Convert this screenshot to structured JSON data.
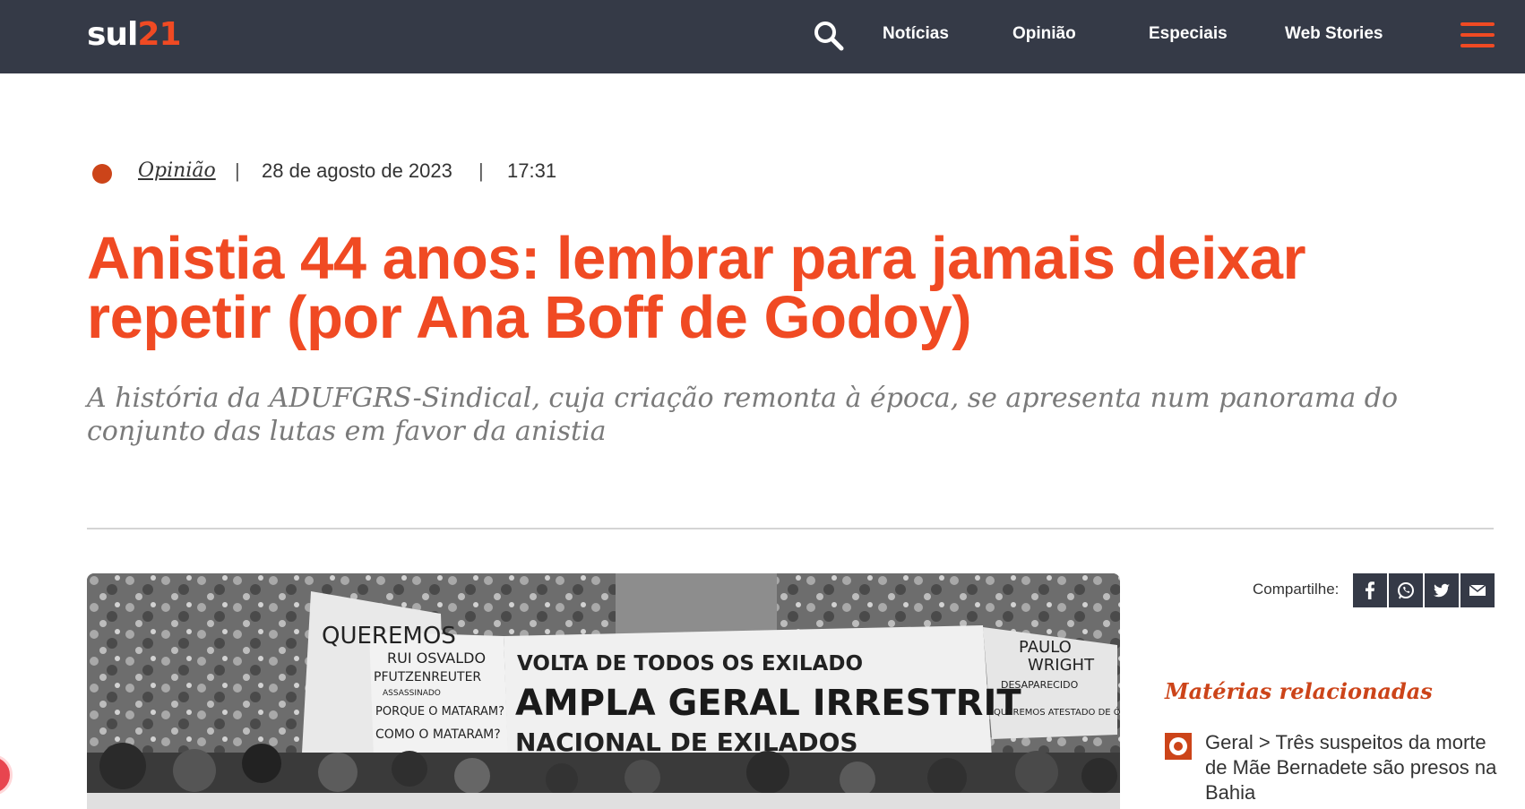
{
  "header": {
    "logo_part1": "sul",
    "logo_part2": "21",
    "nav": [
      "Notícias",
      "Opinião",
      "Especiais",
      "Web Stories"
    ]
  },
  "article": {
    "category": "Opinião",
    "separator": "|",
    "date": "28 de agosto de 2023",
    "time": "17:31",
    "title": "Anistia 44 anos: lembrar para jamais deixar repetir (por Ana Boff de Godoy)",
    "subtitle": "A história da ADUFGRS-Sindical, cuja criação remonta à época, se apresenta num panorama do conjunto das lutas em favor da anistia"
  },
  "share": {
    "label": "Compartilhe:",
    "buttons": [
      "facebook-icon",
      "whatsapp-icon",
      "twitter-icon",
      "email-icon"
    ]
  },
  "related": {
    "heading": "Matérias relacionadas",
    "items": [
      {
        "text": "Geral > Três suspeitos da morte de Mãe Bernadete são presos na Bahia"
      }
    ]
  },
  "hero_banners": {
    "b1": "QUEREMOS",
    "b2": "RUI OSVALDO",
    "b3": "PFUTZENREUTER",
    "b4": "ASSASSINADO",
    "b5": "PORQUE O MATARAM?",
    "b6": "COMO O MATARAM?",
    "b7": "VOLTA DE TODOS OS EXILADO",
    "b8": "AMPLA GERAL IRRESTRIT",
    "b9": "NACIONAL DE EXILADOS",
    "b10": "PAULO",
    "b11": "WRIGHT",
    "b12": "DESAPARECIDO",
    "b13": "QUEREMOS ATESTADO DE ÓBITO"
  },
  "colors": {
    "header_bg": "#353a47",
    "accent": "#f04a23",
    "category_dot": "#cc4419"
  }
}
